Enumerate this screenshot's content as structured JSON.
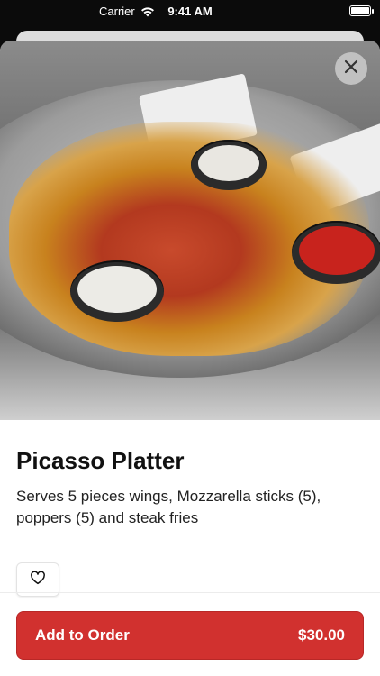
{
  "status_bar": {
    "carrier": "Carrier",
    "time": "9:41 AM",
    "battery_level": 1.0
  },
  "item": {
    "title": "Picasso Platter",
    "description": "Serves 5 pieces wings, Mozzarella sticks (5), poppers (5) and steak fries",
    "image_alt": "platter of wings, mozzarella sticks, poppers and steak fries with dipping sauces"
  },
  "actions": {
    "close_icon": "close-icon",
    "favorite_icon": "heart-outline-icon",
    "add_to_order_label": "Add to Order",
    "price": "$30.00"
  },
  "colors": {
    "accent": "#d1312f",
    "background": "#ffffff",
    "text": "#111111"
  }
}
